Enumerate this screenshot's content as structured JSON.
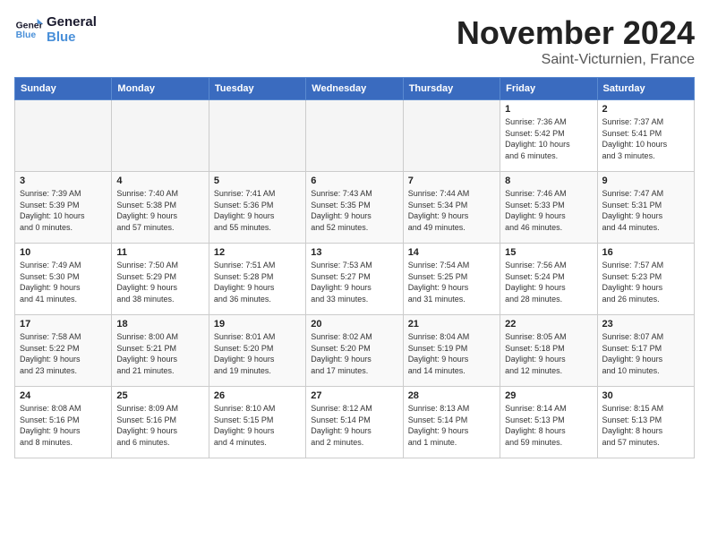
{
  "logo": {
    "line1": "General",
    "line2": "Blue"
  },
  "title": "November 2024",
  "location": "Saint-Victurnien, France",
  "weekdays": [
    "Sunday",
    "Monday",
    "Tuesday",
    "Wednesday",
    "Thursday",
    "Friday",
    "Saturday"
  ],
  "weeks": [
    [
      {
        "day": "",
        "detail": ""
      },
      {
        "day": "",
        "detail": ""
      },
      {
        "day": "",
        "detail": ""
      },
      {
        "day": "",
        "detail": ""
      },
      {
        "day": "",
        "detail": ""
      },
      {
        "day": "1",
        "detail": "Sunrise: 7:36 AM\nSunset: 5:42 PM\nDaylight: 10 hours\nand 6 minutes."
      },
      {
        "day": "2",
        "detail": "Sunrise: 7:37 AM\nSunset: 5:41 PM\nDaylight: 10 hours\nand 3 minutes."
      }
    ],
    [
      {
        "day": "3",
        "detail": "Sunrise: 7:39 AM\nSunset: 5:39 PM\nDaylight: 10 hours\nand 0 minutes."
      },
      {
        "day": "4",
        "detail": "Sunrise: 7:40 AM\nSunset: 5:38 PM\nDaylight: 9 hours\nand 57 minutes."
      },
      {
        "day": "5",
        "detail": "Sunrise: 7:41 AM\nSunset: 5:36 PM\nDaylight: 9 hours\nand 55 minutes."
      },
      {
        "day": "6",
        "detail": "Sunrise: 7:43 AM\nSunset: 5:35 PM\nDaylight: 9 hours\nand 52 minutes."
      },
      {
        "day": "7",
        "detail": "Sunrise: 7:44 AM\nSunset: 5:34 PM\nDaylight: 9 hours\nand 49 minutes."
      },
      {
        "day": "8",
        "detail": "Sunrise: 7:46 AM\nSunset: 5:33 PM\nDaylight: 9 hours\nand 46 minutes."
      },
      {
        "day": "9",
        "detail": "Sunrise: 7:47 AM\nSunset: 5:31 PM\nDaylight: 9 hours\nand 44 minutes."
      }
    ],
    [
      {
        "day": "10",
        "detail": "Sunrise: 7:49 AM\nSunset: 5:30 PM\nDaylight: 9 hours\nand 41 minutes."
      },
      {
        "day": "11",
        "detail": "Sunrise: 7:50 AM\nSunset: 5:29 PM\nDaylight: 9 hours\nand 38 minutes."
      },
      {
        "day": "12",
        "detail": "Sunrise: 7:51 AM\nSunset: 5:28 PM\nDaylight: 9 hours\nand 36 minutes."
      },
      {
        "day": "13",
        "detail": "Sunrise: 7:53 AM\nSunset: 5:27 PM\nDaylight: 9 hours\nand 33 minutes."
      },
      {
        "day": "14",
        "detail": "Sunrise: 7:54 AM\nSunset: 5:25 PM\nDaylight: 9 hours\nand 31 minutes."
      },
      {
        "day": "15",
        "detail": "Sunrise: 7:56 AM\nSunset: 5:24 PM\nDaylight: 9 hours\nand 28 minutes."
      },
      {
        "day": "16",
        "detail": "Sunrise: 7:57 AM\nSunset: 5:23 PM\nDaylight: 9 hours\nand 26 minutes."
      }
    ],
    [
      {
        "day": "17",
        "detail": "Sunrise: 7:58 AM\nSunset: 5:22 PM\nDaylight: 9 hours\nand 23 minutes."
      },
      {
        "day": "18",
        "detail": "Sunrise: 8:00 AM\nSunset: 5:21 PM\nDaylight: 9 hours\nand 21 minutes."
      },
      {
        "day": "19",
        "detail": "Sunrise: 8:01 AM\nSunset: 5:20 PM\nDaylight: 9 hours\nand 19 minutes."
      },
      {
        "day": "20",
        "detail": "Sunrise: 8:02 AM\nSunset: 5:20 PM\nDaylight: 9 hours\nand 17 minutes."
      },
      {
        "day": "21",
        "detail": "Sunrise: 8:04 AM\nSunset: 5:19 PM\nDaylight: 9 hours\nand 14 minutes."
      },
      {
        "day": "22",
        "detail": "Sunrise: 8:05 AM\nSunset: 5:18 PM\nDaylight: 9 hours\nand 12 minutes."
      },
      {
        "day": "23",
        "detail": "Sunrise: 8:07 AM\nSunset: 5:17 PM\nDaylight: 9 hours\nand 10 minutes."
      }
    ],
    [
      {
        "day": "24",
        "detail": "Sunrise: 8:08 AM\nSunset: 5:16 PM\nDaylight: 9 hours\nand 8 minutes."
      },
      {
        "day": "25",
        "detail": "Sunrise: 8:09 AM\nSunset: 5:16 PM\nDaylight: 9 hours\nand 6 minutes."
      },
      {
        "day": "26",
        "detail": "Sunrise: 8:10 AM\nSunset: 5:15 PM\nDaylight: 9 hours\nand 4 minutes."
      },
      {
        "day": "27",
        "detail": "Sunrise: 8:12 AM\nSunset: 5:14 PM\nDaylight: 9 hours\nand 2 minutes."
      },
      {
        "day": "28",
        "detail": "Sunrise: 8:13 AM\nSunset: 5:14 PM\nDaylight: 9 hours\nand 1 minute."
      },
      {
        "day": "29",
        "detail": "Sunrise: 8:14 AM\nSunset: 5:13 PM\nDaylight: 8 hours\nand 59 minutes."
      },
      {
        "day": "30",
        "detail": "Sunrise: 8:15 AM\nSunset: 5:13 PM\nDaylight: 8 hours\nand 57 minutes."
      }
    ]
  ]
}
